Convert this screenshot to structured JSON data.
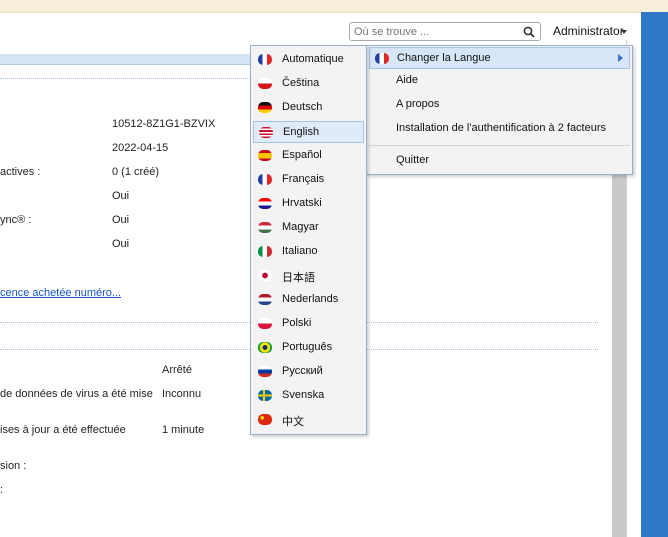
{
  "search": {
    "placeholder": "Où se trouve ..."
  },
  "user": {
    "name": "Administrator"
  },
  "license_info": {
    "rows": [
      {
        "label": "",
        "value": "10512-8Z1G1-BZVIX"
      },
      {
        "label": "",
        "value": "2022-04-15"
      },
      {
        "label": "actives :",
        "value": "0 (1 créé)"
      },
      {
        "label": "",
        "value": "Oui"
      },
      {
        "label": "ync® :",
        "value": "Oui"
      },
      {
        "label": "",
        "value": "Oui"
      }
    ],
    "link": "cence achetée numéro..."
  },
  "update_info": {
    "rows": [
      {
        "label": "",
        "value": "Arrêté"
      },
      {
        "label": "de données de virus a été mise",
        "value": "Inconnu"
      },
      {
        "label": "ises à jour a été effectuée",
        "value": "1 minute"
      },
      {
        "label": "sion :",
        "value": ""
      },
      {
        "label": ":",
        "value": ""
      }
    ]
  },
  "language_menu": {
    "selected": "English",
    "items": [
      {
        "label": "Automatique",
        "flag": "fr"
      },
      {
        "label": "Čeština",
        "flag": "cz"
      },
      {
        "label": "Deutsch",
        "flag": "de"
      },
      {
        "label": "English",
        "flag": "us"
      },
      {
        "label": "Español",
        "flag": "es"
      },
      {
        "label": "Français",
        "flag": "fr"
      },
      {
        "label": "Hrvatski",
        "flag": "hr"
      },
      {
        "label": "Magyar",
        "flag": "hu"
      },
      {
        "label": "Italiano",
        "flag": "it"
      },
      {
        "label": "日本語",
        "flag": "jp"
      },
      {
        "label": "Nederlands",
        "flag": "nl"
      },
      {
        "label": "Polski",
        "flag": "pl"
      },
      {
        "label": "Português",
        "flag": "br"
      },
      {
        "label": "Русский",
        "flag": "ru"
      },
      {
        "label": "Svenska",
        "flag": "se"
      },
      {
        "label": "中文",
        "flag": "cn"
      }
    ]
  },
  "account_menu": {
    "items": [
      {
        "label": "Changer la Langue",
        "flag": "fr"
      },
      {
        "label": "Aide"
      },
      {
        "label": "A propos"
      },
      {
        "label": "Installation de l'authentification à 2 facteurs"
      },
      {
        "label": "Quitter"
      }
    ]
  },
  "colors": {
    "accent": "#2f78c8",
    "menu_bg": "#f3f3f3",
    "selected_bg": "#e1ebf8",
    "link": "#1a55c5"
  }
}
